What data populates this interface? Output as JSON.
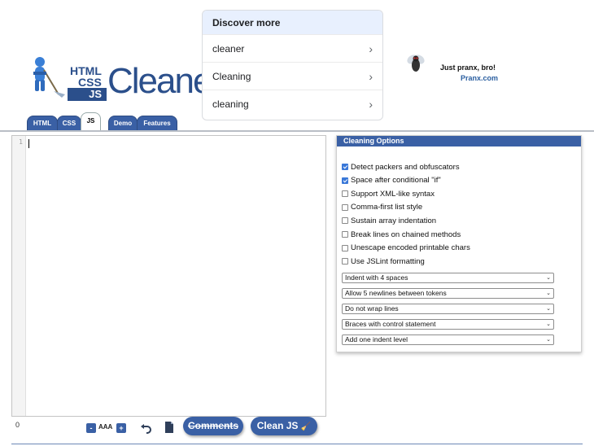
{
  "logo": {
    "small_top": "HTML",
    "small_mid": "CSS",
    "small_js": "JS",
    "big": "Cleaner"
  },
  "discover": {
    "title": "Discover more",
    "items": [
      {
        "label": "cleaner",
        "icon": "chevron-right-icon"
      },
      {
        "label": "Cleaning",
        "icon": "chevron-right-icon"
      },
      {
        "label": "cleaning",
        "icon": "chevron-right-icon"
      }
    ]
  },
  "ad": {
    "line1": "Just pranx, bro!",
    "line2": "Pranx.com"
  },
  "tabs": [
    {
      "label": "HTML",
      "active": false
    },
    {
      "label": "CSS",
      "active": false
    },
    {
      "label": "JS",
      "active": true
    },
    {
      "label": "Demo",
      "active": false
    },
    {
      "label": "Features",
      "active": false
    }
  ],
  "editor": {
    "line_number": "1",
    "content": ""
  },
  "toolbar": {
    "char_count": "0",
    "font_dec": "-",
    "font_size_label": "AAA",
    "font_inc": "+",
    "comments_label": "Comments",
    "clean_label": "Clean JS"
  },
  "options": {
    "title": "Cleaning Options",
    "checkboxes": [
      {
        "label": "Detect packers and obfuscators",
        "checked": true
      },
      {
        "label": "Space after conditional \"if\"",
        "checked": true
      },
      {
        "label": "Support XML-like syntax",
        "checked": false
      },
      {
        "label": "Comma-first list style",
        "checked": false
      },
      {
        "label": "Sustain array indentation",
        "checked": false
      },
      {
        "label": "Break lines on chained methods",
        "checked": false
      },
      {
        "label": "Unescape encoded printable chars",
        "checked": false
      },
      {
        "label": "Use JSLint formatting",
        "checked": false
      }
    ],
    "selects": [
      {
        "value": "Indent with 4 spaces"
      },
      {
        "value": "Allow 5 newlines between tokens"
      },
      {
        "value": "Do not wrap lines"
      },
      {
        "value": "Braces with control statement"
      },
      {
        "value": "Add one indent level"
      }
    ]
  },
  "colors": {
    "brand_blue": "#3a60a5",
    "logo_blue": "#2b4f8b",
    "discover_header_bg": "#e8f0fe"
  }
}
